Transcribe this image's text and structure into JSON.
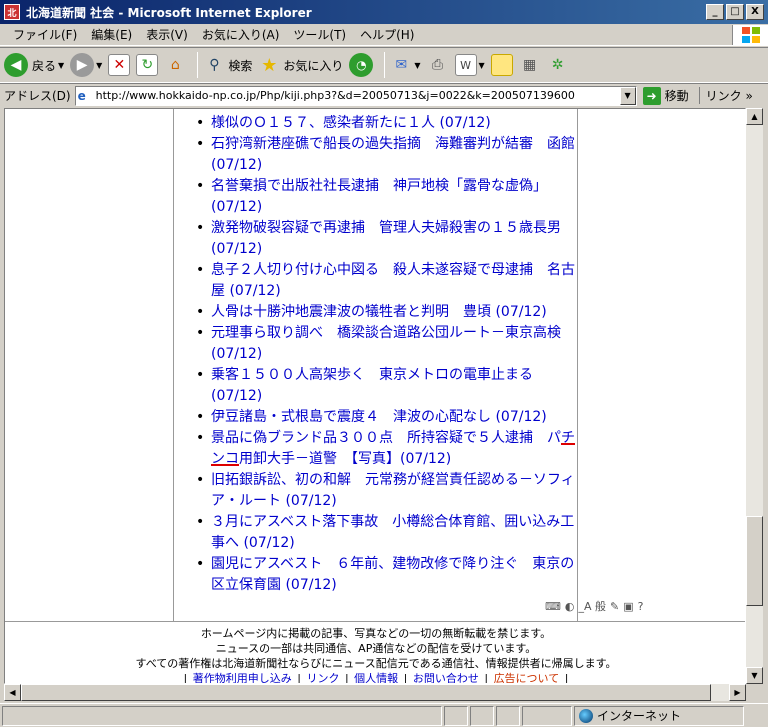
{
  "window": {
    "title": "北海道新聞 社会 - Microsoft Internet Explorer",
    "minimize": "_",
    "maximize": "□",
    "close": "X"
  },
  "menu": [
    "ファイル(F)",
    "編集(E)",
    "表示(V)",
    "お気に入り(A)",
    "ツール(T)",
    "ヘルプ(H)"
  ],
  "toolbar": {
    "back_label": "戻る",
    "search_label": "検索",
    "favorites_label": "お気に入り"
  },
  "address": {
    "label": "アドレス(D)",
    "url": "http://www.hokkaido-np.co.jp/Php/kiji.php3?&d=20050713&j=0022&k=200507139600",
    "go_label": "移動",
    "links_label": "リンク"
  },
  "news": [
    {
      "title": "様似のＯ１５７、感染者新たに１人",
      "date": "(07/12)"
    },
    {
      "title": "石狩湾新港座礁で船長の過失指摘　海難審判が結審　函館",
      "date": "(07/12)"
    },
    {
      "title": "名誉棄損で出版社社長逮捕　神戸地検「露骨な虚偽」",
      "date": "(07/12)"
    },
    {
      "title": "激発物破裂容疑で再逮捕　管理人夫婦殺害の１５歳長男",
      "date": "(07/12)"
    },
    {
      "title": "息子２人切り付け心中図る　殺人未遂容疑で母逮捕　名古屋",
      "date": "(07/12)"
    },
    {
      "title": "人骨は十勝沖地震津波の犠牲者と判明　豊頃",
      "date": "(07/12)"
    },
    {
      "title": "元理事ら取り調べ　橋梁談合道路公団ルート－東京高検",
      "date": "(07/12)"
    },
    {
      "title": "乗客１５００人高架歩く　東京メトロの電車止まる",
      "date": "(07/12)"
    },
    {
      "title": "伊豆諸島・式根島で震度４　津波の心配なし",
      "date": "(07/12)"
    },
    {
      "title_a": "景品に偽ブランド品３００点　所持容疑で５人逮捕　パ",
      "title_b": "チンコ",
      "title_c": "用卸大手－道警　【写真】",
      "date": "(07/12)"
    },
    {
      "title": "旧拓銀訴訟、初の和解　元常務が経営責任認める－ソフィア・ルート",
      "date": "(07/12)"
    },
    {
      "title": "３月にアスベスト落下事故　小樽総合体育館、囲い込み工事へ",
      "date": "(07/12)"
    },
    {
      "title": "園児にアスベスト　６年前、建物改修で降り注ぐ　東京の区立保育園",
      "date": "(07/12)"
    }
  ],
  "ime_text": "_A 般",
  "footer": {
    "line1": "ホームページ内に掲載の記事、写真などの一切の無断転載を禁じます。",
    "line2": "ニュースの一部は共同通信、AP通信などの配信を受けています。",
    "line3": "すべての著作権は北海道新聞社ならびにニュース配信元である通信社、情報提供者に帰属します。",
    "links": [
      "著作物利用申し込み",
      "リンク",
      "個人情報",
      "お問い合わせ",
      "広告について"
    ]
  },
  "status": {
    "zone": "インターネット"
  }
}
